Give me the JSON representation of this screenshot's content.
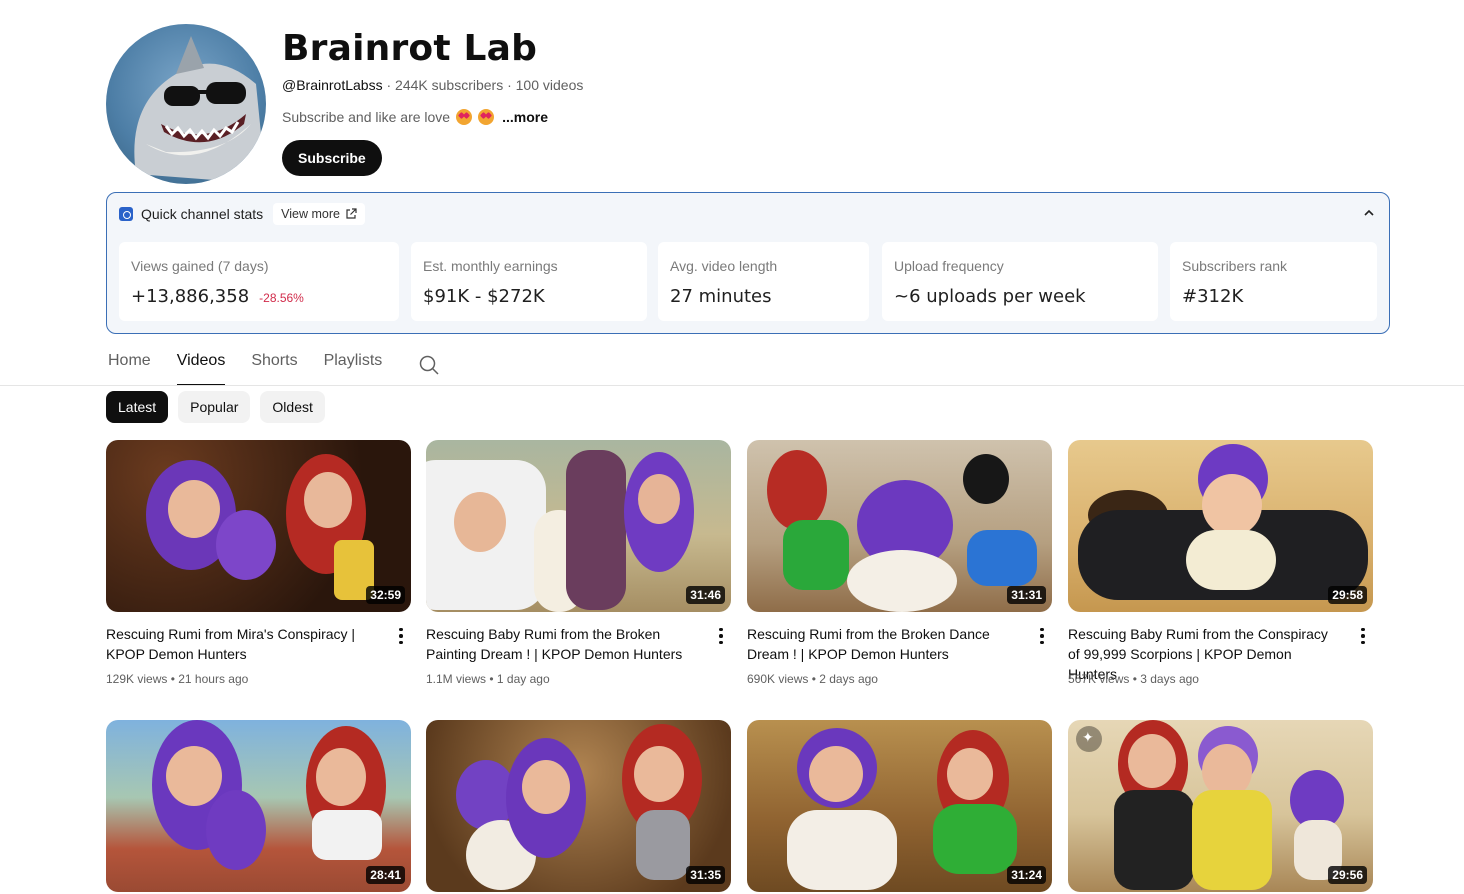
{
  "channel": {
    "name": "Brainrot Lab",
    "handle": "@BrainrotLabss",
    "meta": "· 244K subscribers · 100 videos",
    "description": "Subscribe and like are love",
    "more_label": "...more",
    "subscribe_label": "Subscribe"
  },
  "stats": {
    "title": "Quick channel stats",
    "view_more_label": "View more",
    "cards": [
      {
        "label": "Views gained (7 days)",
        "value": "+13,886,358",
        "change": "-28.56%"
      },
      {
        "label": "Est. monthly earnings",
        "value": "$91K - $272K"
      },
      {
        "label": "Avg. video length",
        "value": "27 minutes"
      },
      {
        "label": "Upload frequency",
        "value": "~6 uploads per week"
      },
      {
        "label": "Subscribers rank",
        "value": "#312K"
      }
    ]
  },
  "tabs": [
    {
      "label": "Home"
    },
    {
      "label": "Videos",
      "active": true
    },
    {
      "label": "Shorts"
    },
    {
      "label": "Playlists"
    }
  ],
  "chips": [
    {
      "label": "Latest",
      "active": true
    },
    {
      "label": "Popular"
    },
    {
      "label": "Oldest"
    }
  ],
  "videos": [
    {
      "title": "Rescuing Rumi from Mira's Conspiracy | KPOP Demon Hunters",
      "views": "129K views",
      "age": "21 hours ago",
      "duration": "32:59"
    },
    {
      "title": "Rescuing Baby Rumi from the Broken Painting Dream ! | KPOP Demon Hunters",
      "views": "1.1M views",
      "age": "1 day ago",
      "duration": "31:46"
    },
    {
      "title": "Rescuing Rumi from the Broken Dance Dream ! | KPOP Demon Hunters",
      "views": "690K views",
      "age": "2 days ago",
      "duration": "31:31"
    },
    {
      "title": "Rescuing Baby Rumi from the Conspiracy of 99,999 Scorpions | KPOP Demon Hunters",
      "views": "567K views",
      "age": "3 days ago",
      "duration": "29:58"
    },
    {
      "duration": "28:41"
    },
    {
      "duration": "31:35"
    },
    {
      "duration": "31:24"
    },
    {
      "duration": "29:56"
    }
  ],
  "colors": {
    "accent_border": "#3b6fb6",
    "negative_change": "#d12b4a",
    "purple_hair": "#7b3fc4",
    "red_hair": "#c8312a"
  }
}
